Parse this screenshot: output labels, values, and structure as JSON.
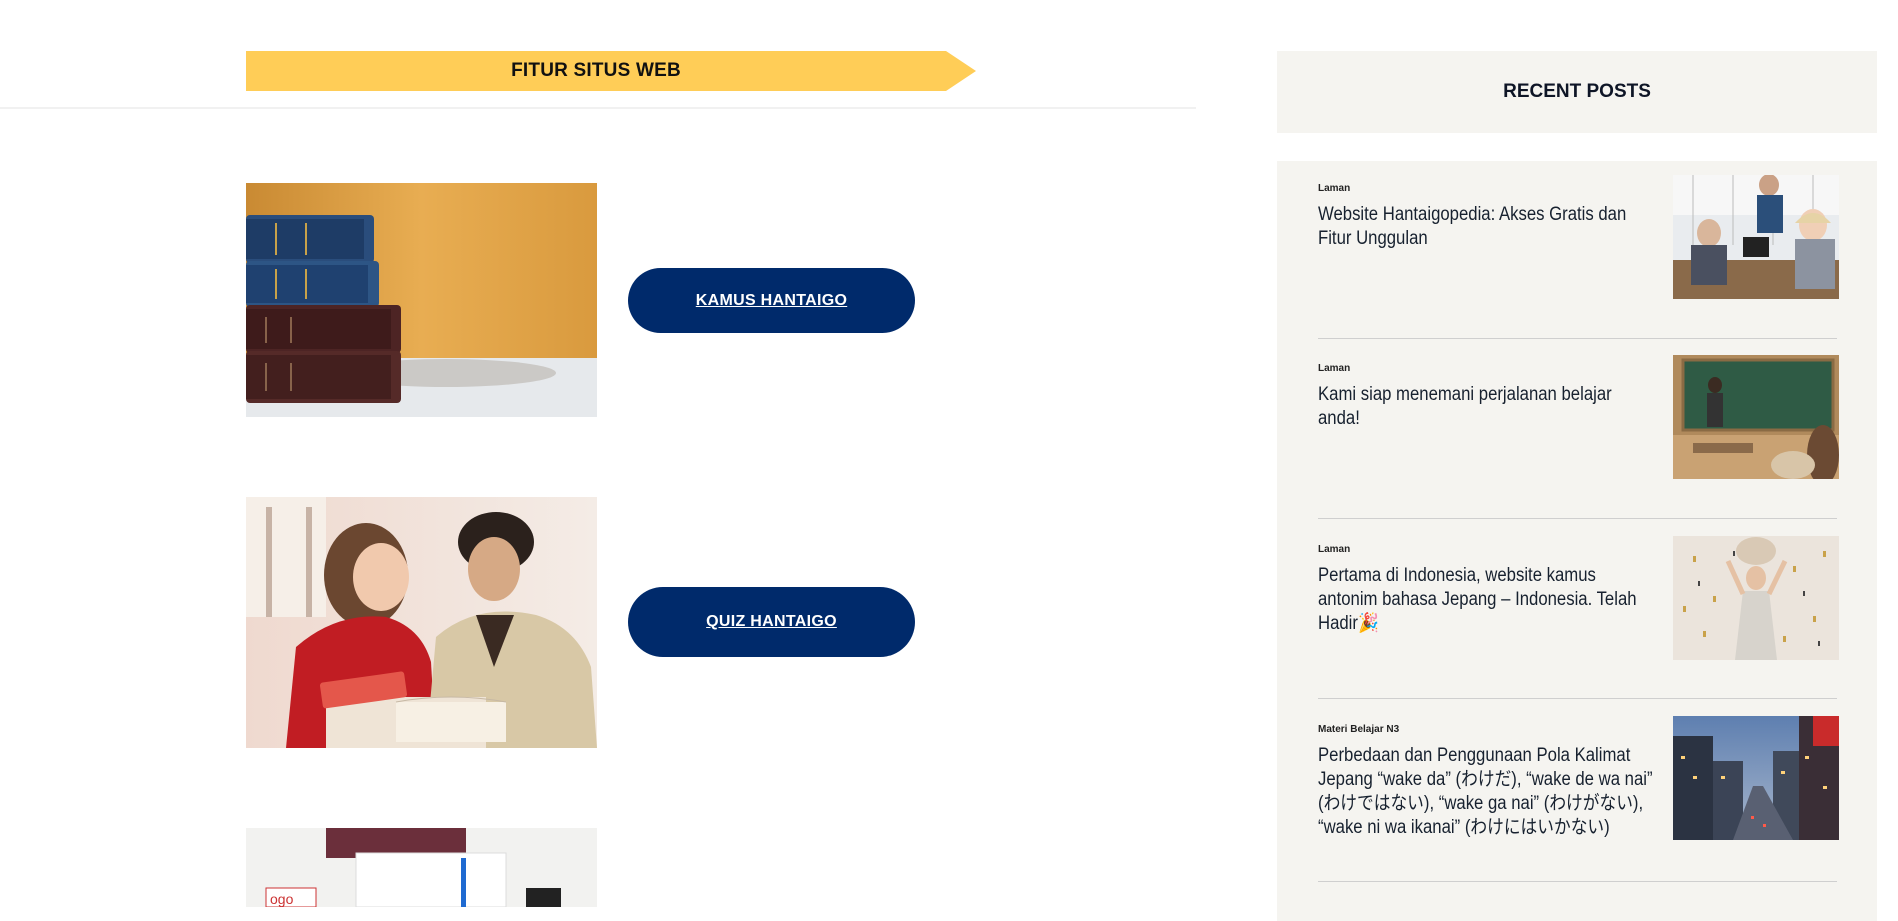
{
  "features": {
    "banner_title": "FITUR SITUS WEB",
    "items": [
      {
        "label": "KAMUS HANTAIGO"
      },
      {
        "label": "QUIZ HANTAIGO"
      }
    ]
  },
  "sidebar": {
    "title": "RECENT POSTS",
    "posts": [
      {
        "category": "Laman",
        "title": "Website Hantaigopedia: Akses Gratis dan Fitur Unggulan"
      },
      {
        "category": "Laman",
        "title": "Kami siap menemani perjalanan belajar anda!"
      },
      {
        "category": "Laman",
        "title": "Pertama di Indonesia, website kamus antonim bahasa Jepang – Indonesia. Telah Hadir🎉"
      },
      {
        "category": "Materi Belajar N3",
        "title": "Perbedaan dan Penggunaan Pola Kalimat Jepang “wake da” (わけだ), “wake de wa nai” (わけではない), “wake ga nai” (わけがない), “wake ni wa ikanai” (わけにはいかない)"
      }
    ]
  },
  "colors": {
    "banner": "#ffcd57",
    "button": "#002a6b",
    "sidebar_bg": "#f5f4f0"
  }
}
